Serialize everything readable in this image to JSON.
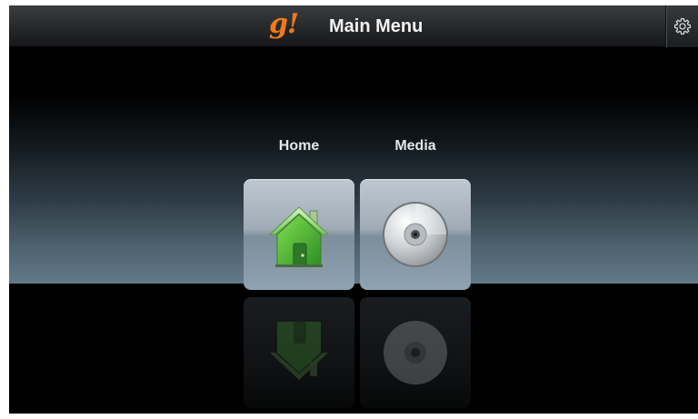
{
  "header": {
    "logo_text": "g!",
    "title": "Main Menu",
    "settings_icon": "gear-icon"
  },
  "menu": {
    "items": [
      {
        "label": "Home",
        "icon": "house-icon"
      },
      {
        "label": "Media",
        "icon": "disc-icon"
      }
    ]
  },
  "colors": {
    "logo": "#f07a1a",
    "house_green": "#5cc63c",
    "text": "#e6e6e6"
  }
}
